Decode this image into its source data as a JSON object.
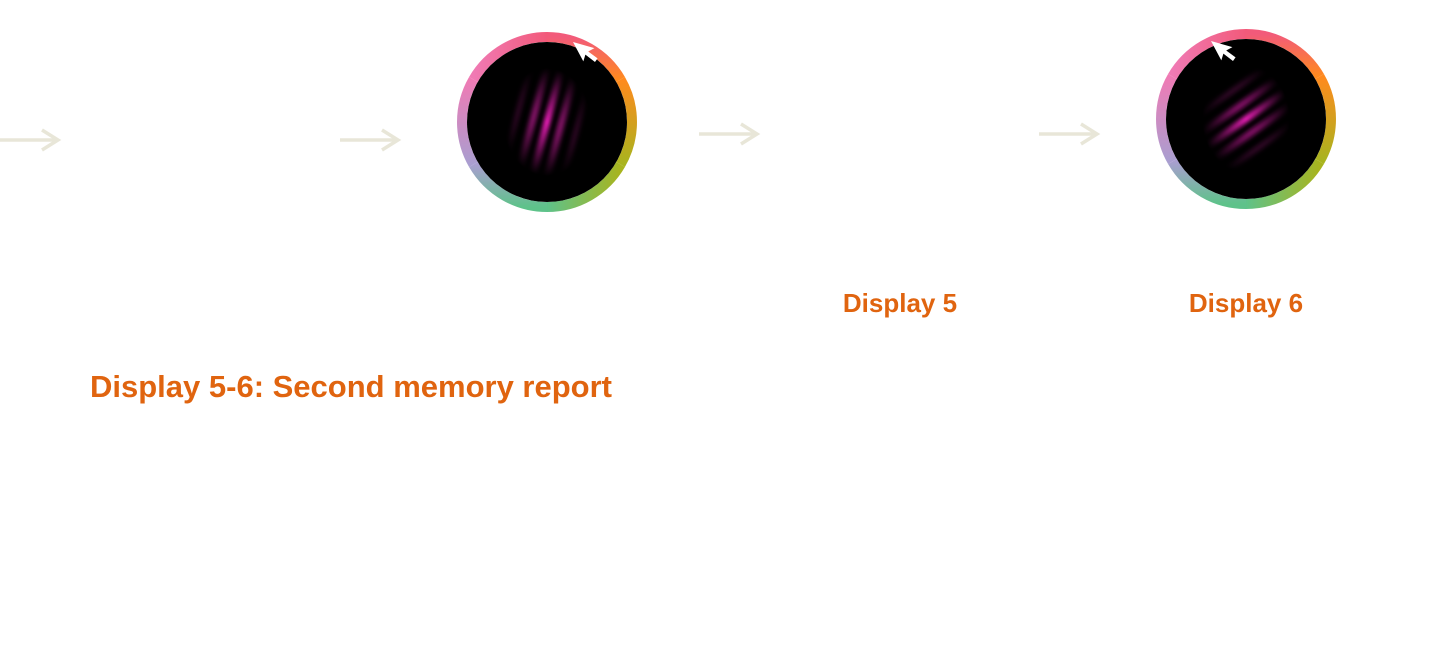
{
  "colors": {
    "accent_label": "#e0640f",
    "arrow": "#e8e6d8",
    "disc_background": "#000000",
    "grating": "#e61eb4",
    "cursor": "#ffffff"
  },
  "icons": {
    "arrow": "right-arrow-icon",
    "cursor": "mouse-pointer-icon"
  },
  "labels": {
    "display_5": "Display 5",
    "display_6": "Display 6",
    "section_title": "Display 5-6: Second memory report"
  },
  "stimuli": [
    {
      "name": "grating-disc-1",
      "grating_orientation_deg": 15
    },
    {
      "name": "grating-disc-2",
      "grating_orientation_deg": 55
    }
  ]
}
